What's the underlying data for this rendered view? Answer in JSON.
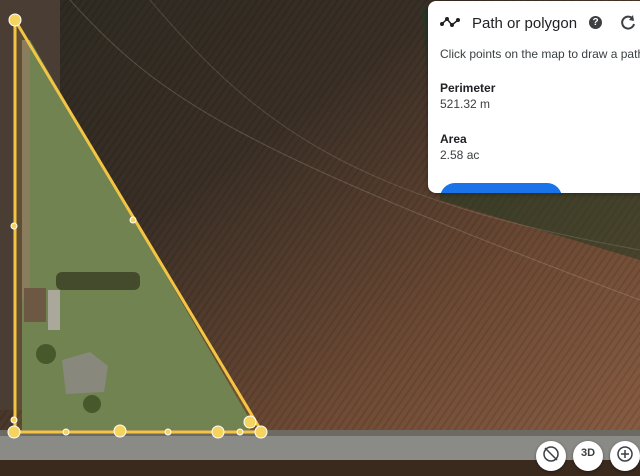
{
  "panel": {
    "title": "Path or polygon",
    "instructions": "Click points on the map to draw a path o",
    "perimeter_label": "Perimeter",
    "perimeter_value": "521.32 m",
    "area_label": "Area",
    "area_value": "2.58 ac",
    "icons": {
      "path": "path-polygon-icon",
      "help": "help-icon",
      "reset": "refresh-icon"
    }
  },
  "controls": {
    "three_d_label": "3D",
    "icons": [
      "compass-icon",
      "3d-toggle",
      "zoom-icon"
    ]
  },
  "colors": {
    "polygon": "#f4c542",
    "accent": "#1a73e8",
    "field": "#6e4a34",
    "grass": "#5f7a52"
  }
}
